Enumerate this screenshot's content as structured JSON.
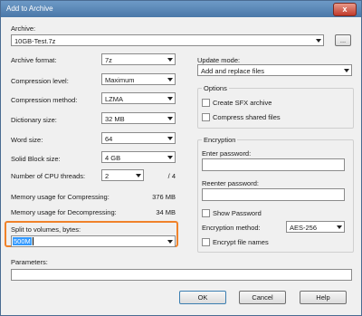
{
  "window": {
    "title": "Add to Archive",
    "close_symbol": "x"
  },
  "archive": {
    "label": "Archive:",
    "value": "10GB-Test.7z",
    "browse_label": "..."
  },
  "left": {
    "archive_format": {
      "label": "Archive format:",
      "value": "7z"
    },
    "compression_level": {
      "label": "Compression level:",
      "value": "Maximum"
    },
    "compression_method": {
      "label": "Compression method:",
      "value": "LZMA"
    },
    "dictionary_size": {
      "label": "Dictionary size:",
      "value": "32 MB"
    },
    "word_size": {
      "label": "Word size:",
      "value": "64"
    },
    "solid_block_size": {
      "label": "Solid Block size:",
      "value": "4 GB"
    },
    "cpu_threads": {
      "label": "Number of CPU threads:",
      "value": "2",
      "total": "/ 4"
    },
    "mem_compress": {
      "label": "Memory usage for Compressing:",
      "value": "376 MB"
    },
    "mem_decompress": {
      "label": "Memory usage for Decompressing:",
      "value": "34 MB"
    },
    "split": {
      "label": "Split to volumes, bytes:",
      "value": "500M",
      "highlight_color": "#f0822a"
    },
    "parameters": {
      "label": "Parameters:",
      "value": ""
    }
  },
  "right": {
    "update_mode": {
      "label": "Update mode:",
      "value": "Add and replace files"
    },
    "options": {
      "title": "Options",
      "sfx_label": "Create SFX archive",
      "shared_label": "Compress shared files"
    },
    "encryption": {
      "title": "Encryption",
      "password_label": "Enter password:",
      "reenter_label": "Reenter password:",
      "show_password_label": "Show Password",
      "method_label": "Encryption method:",
      "method_value": "AES-256",
      "encrypt_names_label": "Encrypt file names"
    }
  },
  "buttons": {
    "ok": "OK",
    "cancel": "Cancel",
    "help": "Help"
  }
}
